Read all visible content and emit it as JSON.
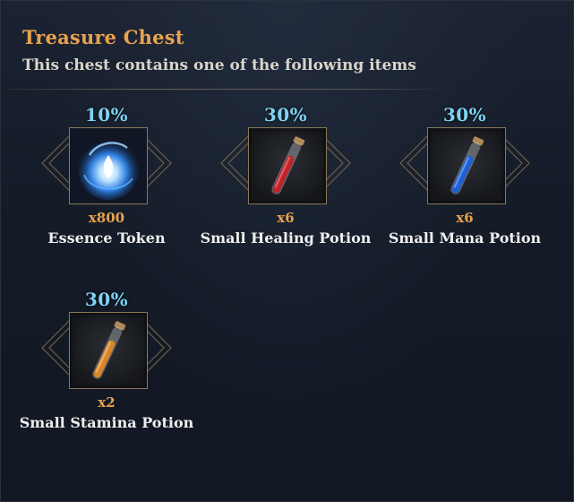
{
  "header": {
    "title": "Treasure Chest",
    "subtitle": "This chest contains one of the following items"
  },
  "items": [
    {
      "chance": "10%",
      "quantity": "x800",
      "name": "Essence Token",
      "icon": "essence-token-icon",
      "color": "#4aa8ff"
    },
    {
      "chance": "30%",
      "quantity": "x6",
      "name": "Small Healing Potion",
      "icon": "healing-potion-icon",
      "color": "#c0242c"
    },
    {
      "chance": "30%",
      "quantity": "x6",
      "name": "Small Mana Potion",
      "icon": "mana-potion-icon",
      "color": "#1f5fd6"
    },
    {
      "chance": "30%",
      "quantity": "x2",
      "name": "Small Stamina Potion",
      "icon": "stamina-potion-icon",
      "color": "#d9862c"
    }
  ],
  "colors": {
    "title": "#e8a24e",
    "chance": "#7ed2f3",
    "quantity": "#e8a24e",
    "name": "#eeeeee"
  }
}
